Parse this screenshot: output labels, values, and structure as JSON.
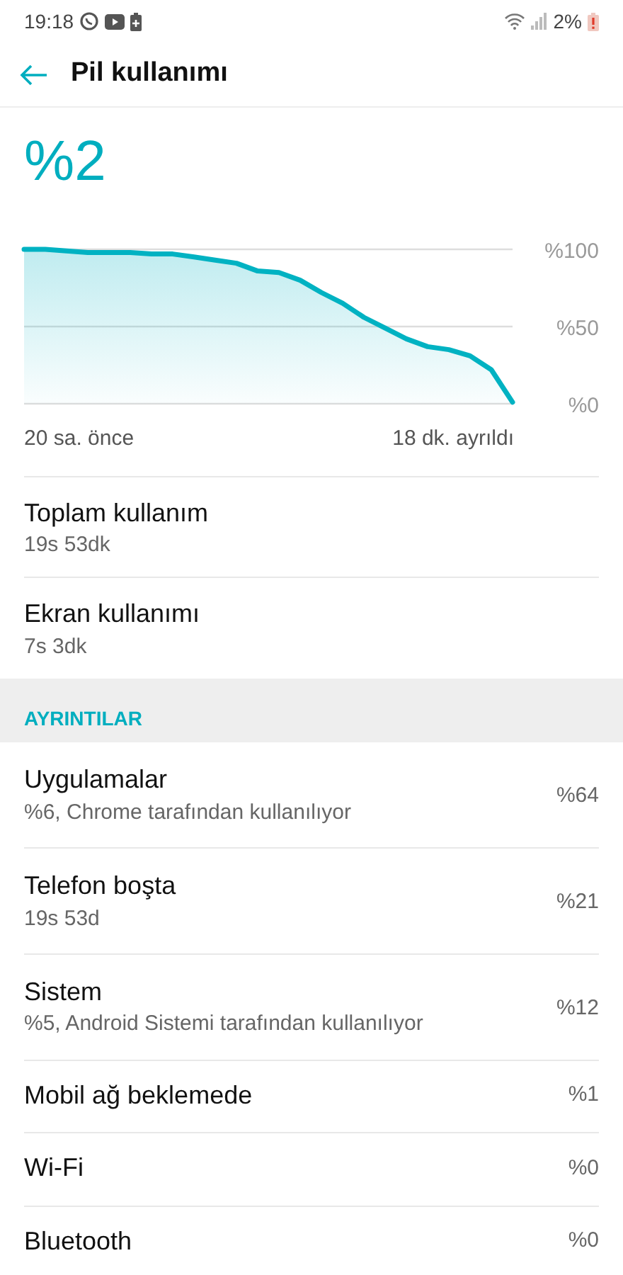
{
  "status_bar": {
    "time": "19:18",
    "battery_percent": "2%"
  },
  "header": {
    "title": "Pil kullanımı"
  },
  "battery_level": "%2",
  "chart_data": {
    "type": "area",
    "series": [
      {
        "color": "#00b2c2",
        "values": [
          100,
          100,
          99,
          98,
          98,
          98,
          97,
          97,
          95,
          93,
          91,
          86,
          85,
          80,
          72,
          65,
          56,
          49,
          42,
          37,
          35,
          31,
          22,
          1
        ]
      }
    ],
    "ylim": [
      0,
      100
    ],
    "yticks": [
      {
        "value": 100,
        "label": "%100"
      },
      {
        "value": 50,
        "label": "%50"
      },
      {
        "value": 0,
        "label": "%0"
      }
    ]
  },
  "chart_time_labels": [
    "20 sa. önce",
    "18 dk. ayrıldı"
  ],
  "summary": [
    {
      "title": "Toplam kullanım",
      "subtitle": "19s 53dk"
    },
    {
      "title": "Ekran kullanımı",
      "subtitle": "7s 3dk"
    }
  ],
  "section_header": "AYRINTILAR",
  "details": [
    {
      "title": "Uygulamalar",
      "subtitle": "%6, Chrome tarafından kullanılıyor",
      "percent": "%64"
    },
    {
      "title": "Telefon boşta",
      "subtitle": "19s 53d",
      "percent": "%21"
    },
    {
      "title": "Sistem",
      "subtitle": "%5, Android Sistemi tarafından kullanılıyor",
      "percent": "%12"
    },
    {
      "title": "Mobil ağ beklemede",
      "percent": "%1"
    },
    {
      "title": "Wi-Fi",
      "percent": "%0"
    },
    {
      "title": "Bluetooth",
      "percent": "%0"
    }
  ]
}
